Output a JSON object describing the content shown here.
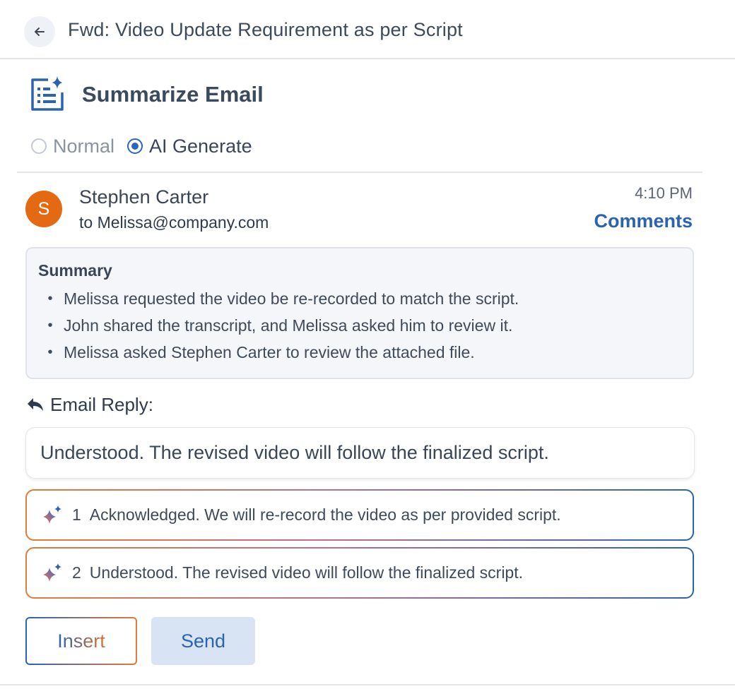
{
  "header": {
    "subject": "Fwd: Video Update Requirement as per Script",
    "back_icon": "arrow-left-icon"
  },
  "summarize": {
    "title": "Summarize Email",
    "icon": "document-sparkle-icon",
    "modes": [
      {
        "label": "Normal",
        "selected": false
      },
      {
        "label": "AI Generate",
        "selected": true
      }
    ]
  },
  "message": {
    "avatar_initial": "S",
    "avatar_color": "#e36a13",
    "sender": "Stephen Carter",
    "to_line": "to Melissa@company.com",
    "time": "4:10 PM",
    "comments_label": "Comments"
  },
  "summary": {
    "title": "Summary",
    "items": [
      "Melissa requested the video be re-recorded to match the script.",
      "John shared the transcript, and Melissa asked him to review it.",
      "Melissa asked Stephen Carter to review the attached file."
    ]
  },
  "reply": {
    "label": "Email Reply:",
    "icon": "reply-arrow-icon",
    "value": "Understood. The revised video will follow the finalized script."
  },
  "suggestions": [
    {
      "number": "1",
      "text": "Acknowledged. We will re-record the video as per provided script.",
      "icon": "ai-sparkle-icon"
    },
    {
      "number": "2",
      "text": "Understood. The revised video will follow the finalized script.",
      "icon": "ai-sparkle-icon"
    }
  ],
  "actions": {
    "insert_label": "Insert",
    "send_label": "Send"
  },
  "colors": {
    "accent": "#2a64b0",
    "avatar": "#e36a13",
    "gradient_orange": "#e07b3c",
    "send_bg": "#d8e4f3"
  }
}
